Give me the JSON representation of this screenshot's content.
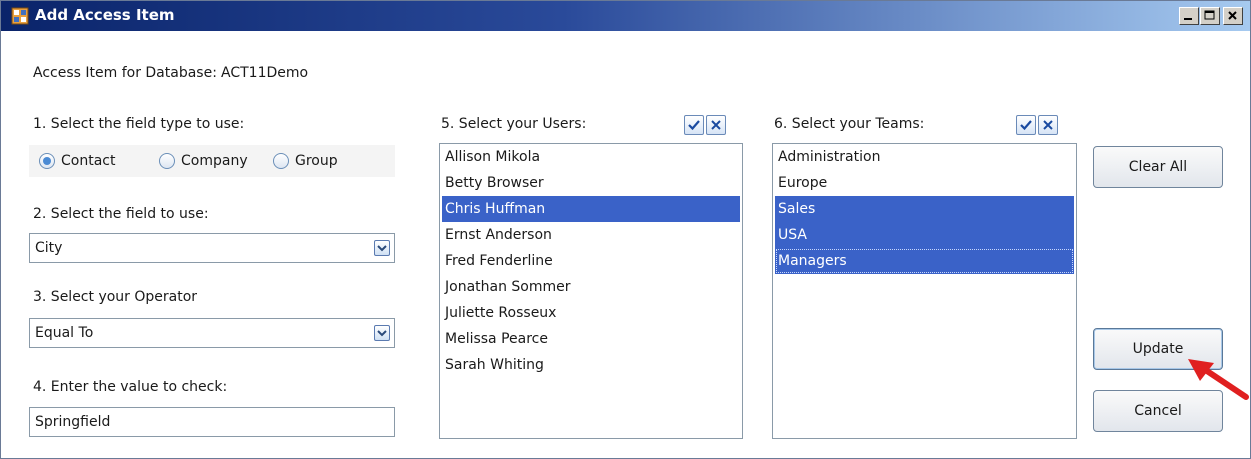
{
  "window": {
    "title": "Add Access Item",
    "controls": [
      "minimize",
      "maximize",
      "close"
    ]
  },
  "header": {
    "database_label": "Access Item for Database:",
    "database_name": "ACT11Demo"
  },
  "step1": {
    "label": "1. Select the field type to use:",
    "options": [
      {
        "label": "Contact",
        "selected": true
      },
      {
        "label": "Company",
        "selected": false
      },
      {
        "label": "Group",
        "selected": false
      }
    ]
  },
  "step2": {
    "label": "2. Select the field to use:",
    "value": "City"
  },
  "step3": {
    "label": "3. Select your Operator",
    "value": "Equal To"
  },
  "step4": {
    "label": "4. Enter the value to check:",
    "value": "Springfield"
  },
  "users": {
    "label": "5. Select your Users:",
    "items": [
      {
        "name": "Allison Mikola",
        "selected": false
      },
      {
        "name": "Betty Browser",
        "selected": false
      },
      {
        "name": "Chris Huffman",
        "selected": true
      },
      {
        "name": "Ernst Anderson",
        "selected": false
      },
      {
        "name": "Fred Fenderline",
        "selected": false
      },
      {
        "name": "Jonathan Sommer",
        "selected": false
      },
      {
        "name": "Juliette Rosseux",
        "selected": false
      },
      {
        "name": "Melissa Pearce",
        "selected": false
      },
      {
        "name": "Sarah Whiting",
        "selected": false
      }
    ]
  },
  "teams": {
    "label": "6. Select your Teams:",
    "items": [
      {
        "name": "Administration",
        "selected": false
      },
      {
        "name": "Europe",
        "selected": false
      },
      {
        "name": "Sales",
        "selected": true
      },
      {
        "name": "USA",
        "selected": true
      },
      {
        "name": "Managers",
        "selected": true
      }
    ]
  },
  "buttons": {
    "clear_all": "Clear All",
    "update": "Update",
    "cancel": "Cancel"
  },
  "icons": {
    "select_all": "checkmark-icon",
    "deselect_all": "x-icon",
    "dropdown": "chevron-down-icon",
    "annotation": "red-arrow-icon"
  },
  "colors": {
    "selection": "#3a62c8",
    "annotation_arrow": "#e02020",
    "titlebar_start": "#0a246a"
  }
}
